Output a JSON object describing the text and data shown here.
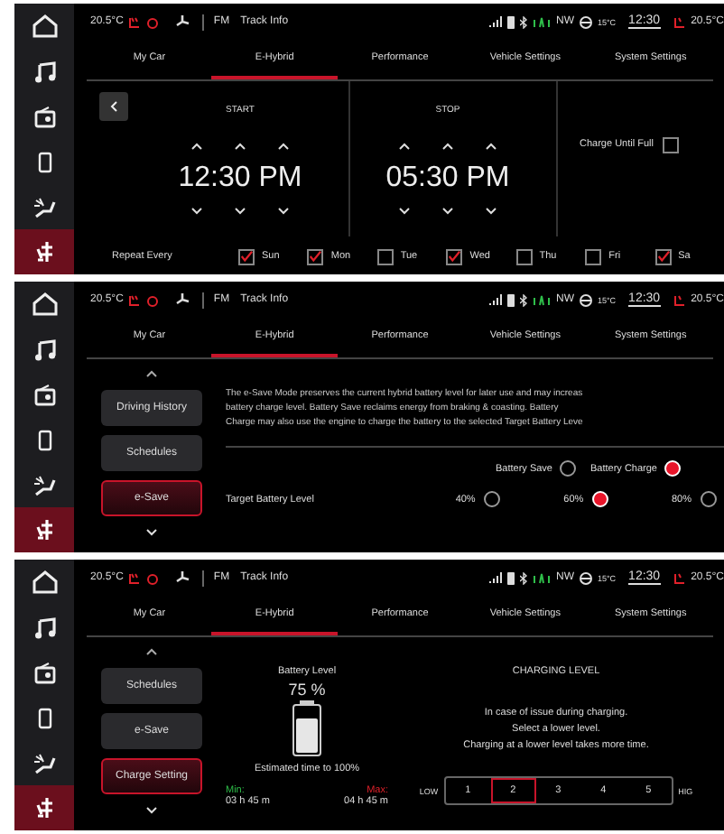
{
  "screens": [
    {
      "status_bar": {
        "outside_temp": "20.5°C",
        "source": "FM",
        "track": "Track Info",
        "heading": "NW",
        "weather_temp": "15°C",
        "clock": "12:30",
        "inside_temp": "20.5°C"
      },
      "tabs": [
        {
          "label": "My Car",
          "selected": false
        },
        {
          "label": "E-Hybrid",
          "selected": true
        },
        {
          "label": "Performance",
          "selected": false
        },
        {
          "label": "Vehicle Settings",
          "selected": false
        },
        {
          "label": "System Settings",
          "selected": false
        }
      ],
      "rail": [
        {
          "selected": false
        },
        {
          "selected": false
        },
        {
          "selected": false
        },
        {
          "selected": false
        },
        {
          "selected": false
        },
        {
          "selected": true
        }
      ],
      "content": {
        "kind": "schedule",
        "start": {
          "label": "START",
          "time": "12:30 PM"
        },
        "stop": {
          "label": "STOP",
          "time": "05:30 PM"
        },
        "charge_until_full": {
          "label": "Charge Until Full",
          "checked": false
        },
        "repeat": {
          "label": "Repeat Every",
          "days": [
            {
              "label": "Sun",
              "checked": true
            },
            {
              "label": "Mon",
              "checked": true
            },
            {
              "label": "Tue",
              "checked": false
            },
            {
              "label": "Wed",
              "checked": true
            },
            {
              "label": "Thu",
              "checked": false
            },
            {
              "label": "Fri",
              "checked": false
            },
            {
              "label": "Sa",
              "checked": true
            }
          ]
        }
      }
    },
    {
      "status_bar": {
        "outside_temp": "20.5°C",
        "source": "FM",
        "track": "Track Info",
        "heading": "NW",
        "weather_temp": "15°C",
        "clock": "12:30",
        "inside_temp": "20.5°C"
      },
      "tabs": [
        {
          "label": "My Car",
          "selected": false
        },
        {
          "label": "E-Hybrid",
          "selected": true
        },
        {
          "label": "Performance",
          "selected": false
        },
        {
          "label": "Vehicle Settings",
          "selected": false
        },
        {
          "label": "System Settings",
          "selected": false
        }
      ],
      "rail": [
        {
          "selected": false
        },
        {
          "selected": false
        },
        {
          "selected": false
        },
        {
          "selected": false
        },
        {
          "selected": false
        },
        {
          "selected": true
        }
      ],
      "content": {
        "kind": "esave",
        "menu": [
          {
            "label": "Driving History",
            "selected": false
          },
          {
            "label": "Schedules",
            "selected": false
          },
          {
            "label": "e-Save",
            "selected": true
          }
        ],
        "description": "The e-Save Mode preserves the current hybrid battery level for later use and may increas\nbattery charge level. Battery Save reclaims energy from braking & coasting. Battery\nCharge may also use the engine to charge the battery to the selected Target Battery Leve",
        "modes": [
          {
            "label": "Battery Save",
            "selected": false
          },
          {
            "label": "Battery Charge",
            "selected": true
          }
        ],
        "target": {
          "label": "Target Battery Level",
          "options": [
            {
              "label": "40%",
              "selected": false
            },
            {
              "label": "60%",
              "selected": true
            },
            {
              "label": "80%",
              "selected": false
            }
          ]
        }
      }
    },
    {
      "status_bar": {
        "outside_temp": "20.5°C",
        "source": "FM",
        "track": "Track Info",
        "heading": "NW",
        "weather_temp": "15°C",
        "clock": "12:30",
        "inside_temp": "20.5°C"
      },
      "tabs": [
        {
          "label": "My Car",
          "selected": false
        },
        {
          "label": "E-Hybrid",
          "selected": true
        },
        {
          "label": "Performance",
          "selected": false
        },
        {
          "label": "Vehicle Settings",
          "selected": false
        },
        {
          "label": "System Settings",
          "selected": false
        }
      ],
      "rail": [
        {
          "selected": false
        },
        {
          "selected": false
        },
        {
          "selected": false
        },
        {
          "selected": false
        },
        {
          "selected": false
        },
        {
          "selected": true
        }
      ],
      "content": {
        "kind": "charge",
        "menu": [
          {
            "label": "Schedules",
            "selected": false
          },
          {
            "label": "e-Save",
            "selected": false
          },
          {
            "label": "Charge Setting",
            "selected": true
          }
        ],
        "battery": {
          "title": "Battery Level",
          "reading": "75 %",
          "level": 0.75,
          "estimate": "Estimated time to 100%",
          "min": {
            "label": "Min:",
            "value": "03 h 45 m"
          },
          "max": {
            "label": "Max:",
            "value": "04 h 45 m"
          }
        },
        "charging": {
          "title": "CHARGING LEVEL",
          "message": "In case of issue during charging.\nSelect a lower level.\nCharging at a lower level takes more time.",
          "low_label": "LOW",
          "high_label": "HIG",
          "levels": [
            {
              "label": "1",
              "selected": false
            },
            {
              "label": "2",
              "selected": true
            },
            {
              "label": "3",
              "selected": false
            },
            {
              "label": "4",
              "selected": false
            },
            {
              "label": "5",
              "selected": false
            }
          ]
        }
      }
    }
  ]
}
